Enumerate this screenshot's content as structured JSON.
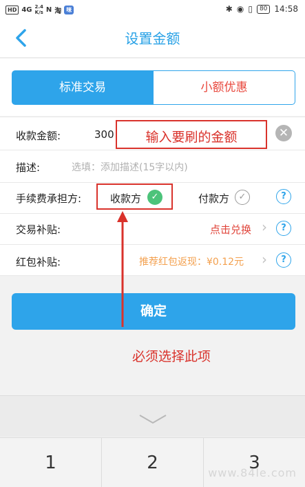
{
  "status_bar": {
    "network": "HD",
    "signal": "4G",
    "speed_value": "2.4",
    "speed_unit": "K/s",
    "icon_nfc": "N",
    "icon_app1": "淘",
    "icon_app2": "咪",
    "battery": "80",
    "time": "14:58"
  },
  "header": {
    "title": "设置金额"
  },
  "tabs": [
    {
      "label": "标准交易"
    },
    {
      "label": "小额优惠"
    }
  ],
  "form": {
    "amount_label": "收款金额:",
    "amount_value": "300",
    "clear_symbol": "✕",
    "desc_label": "描述:",
    "desc_placeholder": "选填：添加描述(15字以内)",
    "fee_label": "手续费承担方:",
    "fee_opt_payee": "收款方",
    "fee_opt_payer": "付款方",
    "check_symbol": "✓",
    "help_symbol": "?",
    "subsidy_label": "交易补贴:",
    "subsidy_action": "点击兑换",
    "redpacket_label": "红包补贴:",
    "redpacket_text": "推荐红包返现：¥0.12元",
    "chevron_symbol": "›"
  },
  "confirm_label": "确定",
  "annotations": {
    "amount_note": "输入要刷的金额",
    "select_note": "必须选择此项"
  },
  "keypad": {
    "keys": [
      "1",
      "2",
      "3"
    ]
  },
  "watermark": "www.84le.com",
  "colors": {
    "accent": "#2ea4ea",
    "title": "#27a1e6",
    "annotation": "#d9322b",
    "selected": "#4cc37a",
    "redeem": "#e0443a",
    "rebate": "#f3a04e"
  }
}
